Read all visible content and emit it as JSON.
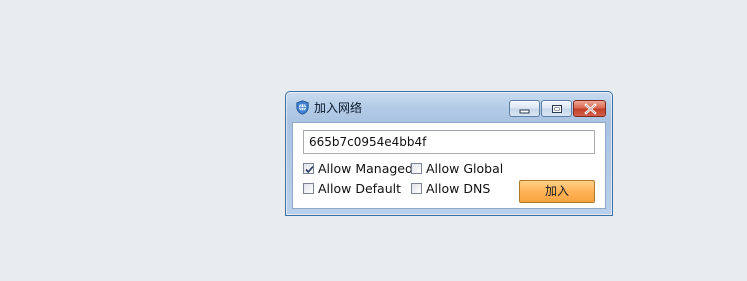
{
  "window": {
    "title": "加入网络",
    "icon": "globe-shield-icon",
    "controls": {
      "minimize": "minimize-icon",
      "maximize": "maximize-icon",
      "close": "close-icon"
    }
  },
  "network_input": {
    "value": "665b7c0954e4bb4f"
  },
  "options": {
    "allow_managed": {
      "label": "Allow Managed",
      "checked": true
    },
    "allow_global": {
      "label": "Allow Global",
      "checked": false
    },
    "allow_default": {
      "label": "Allow Default",
      "checked": false
    },
    "allow_dns": {
      "label": "Allow DNS",
      "checked": false
    }
  },
  "join_button": {
    "label": "加入"
  },
  "colors": {
    "desktop": "#e8ecef",
    "frame": "#b3cbe6",
    "button_accent": "#ffb45a",
    "close_button": "#c2402a"
  }
}
